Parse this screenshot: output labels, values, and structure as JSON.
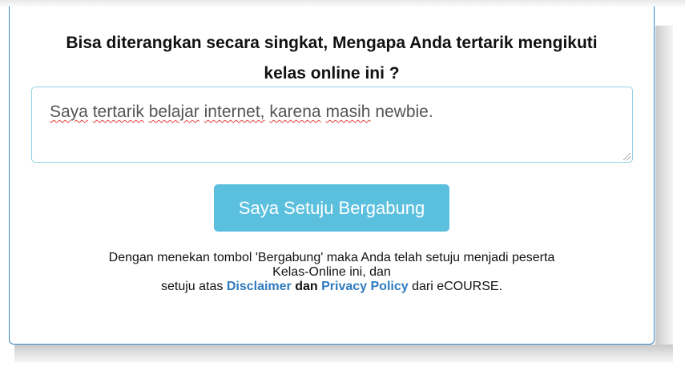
{
  "form": {
    "question_line1": "Bisa diterangkan secara singkat, Mengapa Anda tertarik mengikuti",
    "question_line2": "kelas online ini ?",
    "answer_words": [
      "Saya",
      "tertarik",
      "belajar",
      "internet,",
      "karena",
      "masih",
      "newbie."
    ],
    "join_button_label": "Saya Setuju Bergabung"
  },
  "notice": {
    "line1": "Dengan menekan tombol 'Bergabung' maka Anda telah setuju menjadi peserta",
    "line2": "Kelas-Online ini, dan",
    "line3_prefix": "setuju atas",
    "disclaimer_link": "Disclaimer",
    "connector": "dan",
    "privacy_link": "Privacy Policy",
    "line3_suffix": "dari eCOURSE."
  },
  "colors": {
    "button_bg": "#5bc0de",
    "link": "#2f7bbf",
    "card_border": "#3a88c5",
    "textarea_border": "#8fd3e6"
  }
}
